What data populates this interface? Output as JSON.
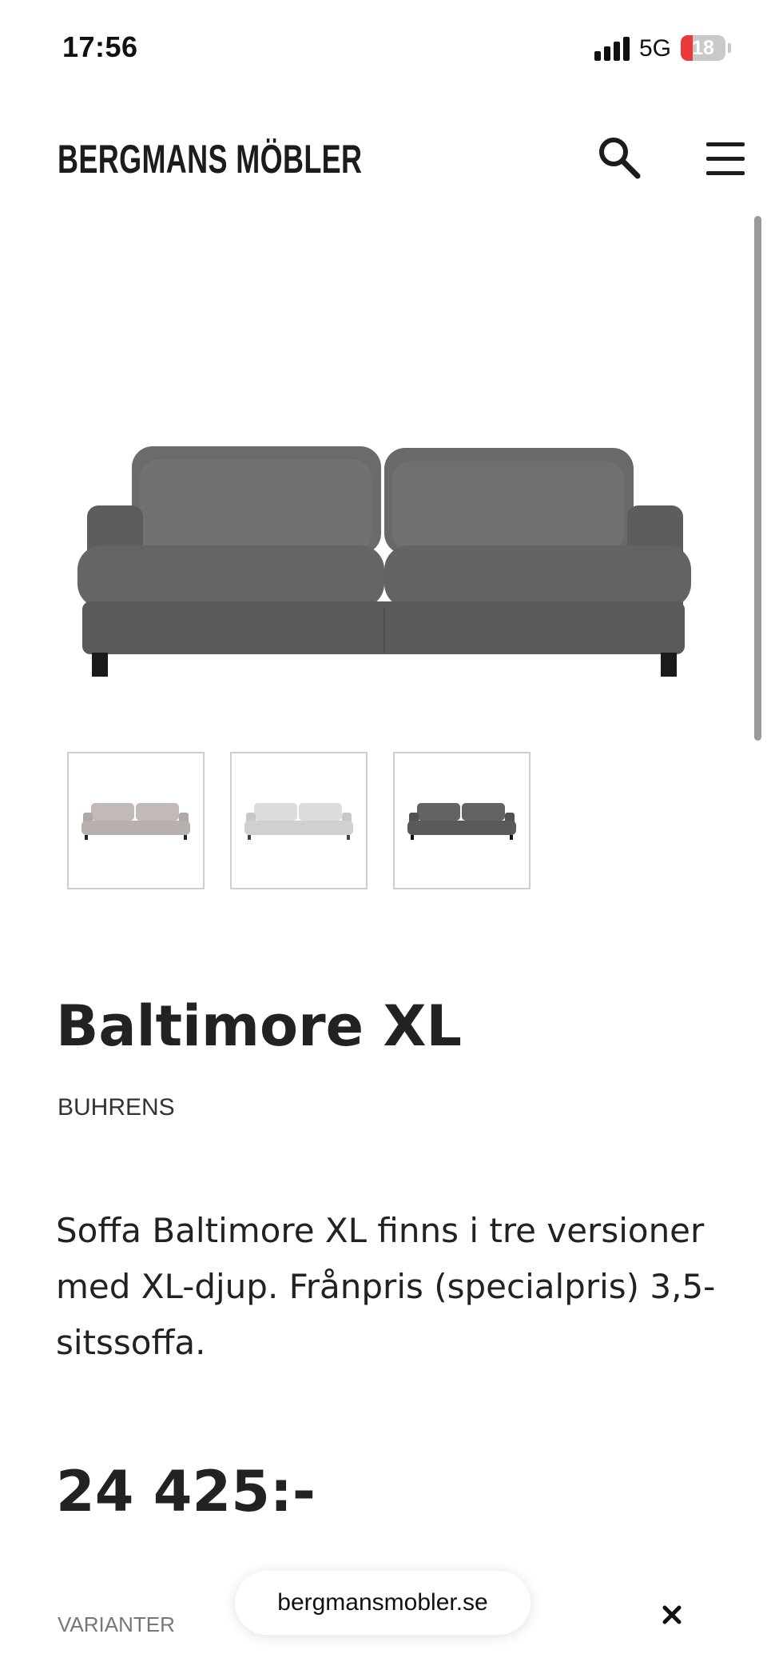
{
  "status_bar": {
    "time": "17:56",
    "network": "5G",
    "battery": "18"
  },
  "header": {
    "brand": "BERGMANS MÖBLER",
    "search_icon": "search-icon",
    "menu_icon": "hamburger-menu-icon"
  },
  "product": {
    "title": "Baltimore XL",
    "brand": "BUHRENS",
    "description": "Soffa Baltimore XL finns i tre versioner med XL-djup. Frånpris (specialpris) 3,5-sitssoffa.",
    "price": "24 425:-",
    "variants_label": "VARIANTER",
    "main_image_color": "#6a6866",
    "thumbnails": [
      {
        "color": "#bcb3b3"
      },
      {
        "color": "#d4d4d4"
      },
      {
        "color": "#5f5e5c"
      }
    ]
  },
  "browser": {
    "url": "bergmansmobler.se",
    "close_icon": "close-icon"
  }
}
